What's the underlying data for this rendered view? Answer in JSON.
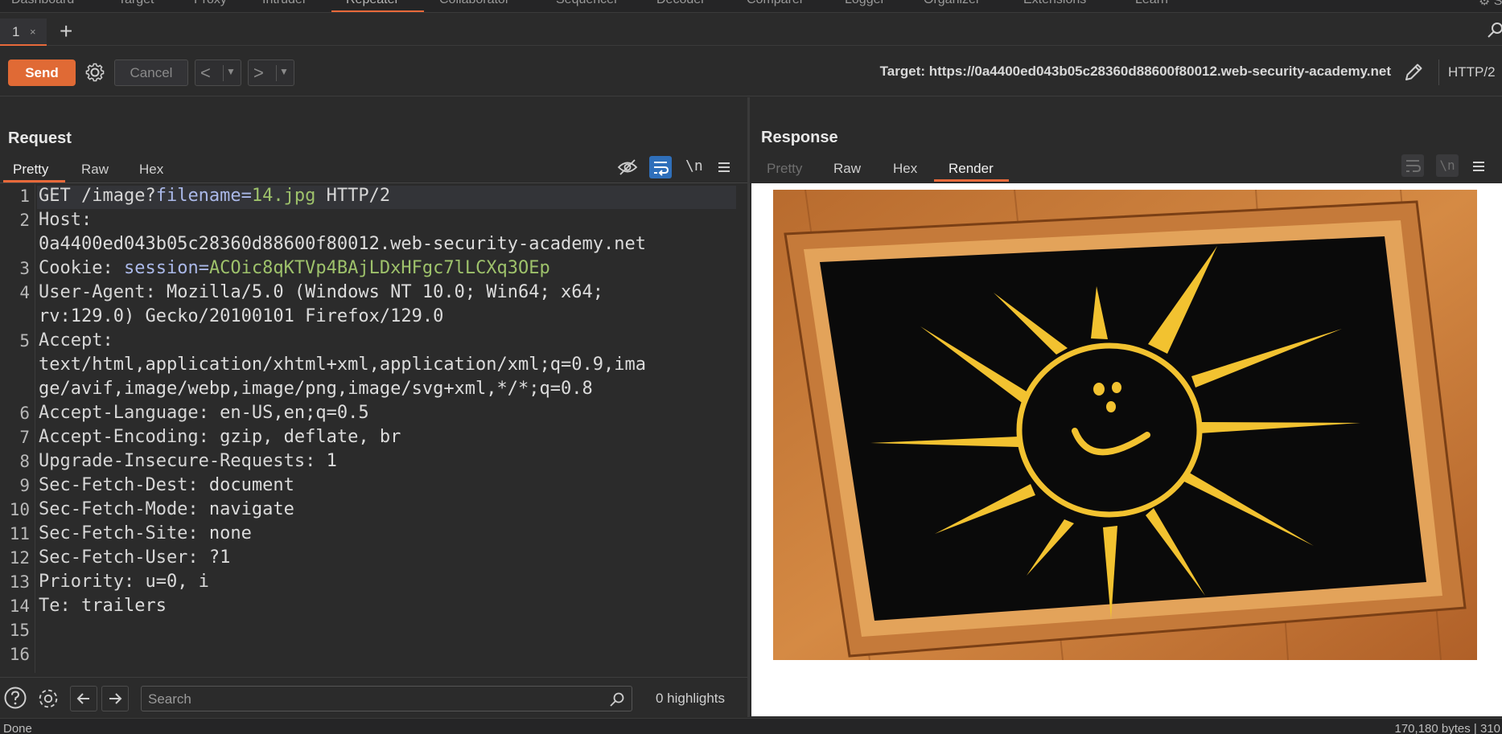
{
  "top_nav": {
    "items": [
      "Dashboard",
      "Target",
      "Proxy",
      "Intruder",
      "Repeater",
      "Collaborator",
      "Sequencer",
      "Decoder",
      "Comparer",
      "Logger",
      "Organizer",
      "Extensions",
      "Learn"
    ],
    "active": "Repeater",
    "settings_label": "Set"
  },
  "tabs": [
    {
      "label": "1",
      "close": "×"
    }
  ],
  "toolbar": {
    "send_label": "Send",
    "cancel_label": "Cancel",
    "target_text": "Target: https://0a4400ed043b05c28360d88600f80012.web-security-academy.net",
    "protocol": "HTTP/2"
  },
  "request": {
    "title": "Request",
    "tabs": [
      "Pretty",
      "Raw",
      "Hex"
    ],
    "active_tab": "Pretty",
    "toolbar_icons": [
      "hide-icon",
      "wrap-icon",
      "newline-icon",
      "menu-icon"
    ],
    "newline_label": "\\n",
    "lines": [
      {
        "n": "1",
        "rows": [
          {
            "parts": [
              [
                "k",
                "GET /image?"
              ],
              [
                "p",
                "filename"
              ],
              [
                "pq",
                "="
              ],
              [
                "pv",
                "14.jpg"
              ],
              [
                "k",
                " HTTP/2"
              ]
            ]
          }
        ]
      },
      {
        "n": "2",
        "rows": [
          {
            "parts": [
              [
                "k",
                "Host:"
              ]
            ]
          },
          {
            "parts": [
              [
                "v",
                "0a4400ed043b05c28360d88600f80012.web-security-academy.net"
              ]
            ]
          }
        ]
      },
      {
        "n": "3",
        "rows": [
          {
            "parts": [
              [
                "k",
                "Cookie: "
              ],
              [
                "p",
                "session"
              ],
              [
                "pq",
                "="
              ],
              [
                "pv",
                "ACOic8qKTVp4BAjLDxHFgc7lLCXq3OEp"
              ]
            ]
          }
        ]
      },
      {
        "n": "4",
        "rows": [
          {
            "parts": [
              [
                "k",
                "User-Agent: "
              ],
              [
                "v",
                "Mozilla/5.0 (Windows NT 10.0; Win64; x64;"
              ]
            ]
          },
          {
            "parts": [
              [
                "v",
                "rv:129.0) Gecko/20100101 Firefox/129.0"
              ]
            ]
          }
        ]
      },
      {
        "n": "5",
        "rows": [
          {
            "parts": [
              [
                "k",
                "Accept:"
              ]
            ]
          },
          {
            "parts": [
              [
                "v",
                "text/html,application/xhtml+xml,application/xml;q=0.9,ima"
              ]
            ]
          },
          {
            "parts": [
              [
                "v",
                "ge/avif,image/webp,image/png,image/svg+xml,*/*;q=0.8"
              ]
            ]
          }
        ]
      },
      {
        "n": "6",
        "rows": [
          {
            "parts": [
              [
                "k",
                "Accept-Language: "
              ],
              [
                "v",
                "en-US,en;q=0.5"
              ]
            ]
          }
        ]
      },
      {
        "n": "7",
        "rows": [
          {
            "parts": [
              [
                "k",
                "Accept-Encoding: "
              ],
              [
                "v",
                "gzip, deflate, br"
              ]
            ]
          }
        ]
      },
      {
        "n": "8",
        "rows": [
          {
            "parts": [
              [
                "k",
                "Upgrade-Insecure-Requests: "
              ],
              [
                "v",
                "1"
              ]
            ]
          }
        ]
      },
      {
        "n": "9",
        "rows": [
          {
            "parts": [
              [
                "k",
                "Sec-Fetch-Dest: "
              ],
              [
                "v",
                "document"
              ]
            ]
          }
        ]
      },
      {
        "n": "10",
        "rows": [
          {
            "parts": [
              [
                "k",
                "Sec-Fetch-Mode: "
              ],
              [
                "v",
                "navigate"
              ]
            ]
          }
        ]
      },
      {
        "n": "11",
        "rows": [
          {
            "parts": [
              [
                "k",
                "Sec-Fetch-Site: "
              ],
              [
                "v",
                "none"
              ]
            ]
          }
        ]
      },
      {
        "n": "12",
        "rows": [
          {
            "parts": [
              [
                "k",
                "Sec-Fetch-User: "
              ],
              [
                "v",
                "?1"
              ]
            ]
          }
        ]
      },
      {
        "n": "13",
        "rows": [
          {
            "parts": [
              [
                "k",
                "Priority: "
              ],
              [
                "v",
                "u=0, i"
              ]
            ]
          }
        ]
      },
      {
        "n": "14",
        "rows": [
          {
            "parts": [
              [
                "k",
                "Te: "
              ],
              [
                "v",
                "trailers"
              ]
            ]
          }
        ]
      },
      {
        "n": "15",
        "rows": [
          {
            "parts": []
          }
        ]
      },
      {
        "n": "16",
        "rows": [
          {
            "parts": []
          }
        ]
      }
    ],
    "search_placeholder": "Search",
    "highlights": "0 highlights"
  },
  "response": {
    "title": "Response",
    "tabs": [
      "Pretty",
      "Raw",
      "Hex",
      "Render"
    ],
    "active_tab": "Render",
    "disabled_tab": "Pretty",
    "newline_label": "\\n"
  },
  "status": {
    "left": "Done",
    "right": "170,180 bytes | 310"
  },
  "colors": {
    "accent": "#e8693a",
    "send": "#e06a35",
    "active_blue": "#2f6fba",
    "param_name": "#aab8e8",
    "param_value": "#9ec26b"
  }
}
